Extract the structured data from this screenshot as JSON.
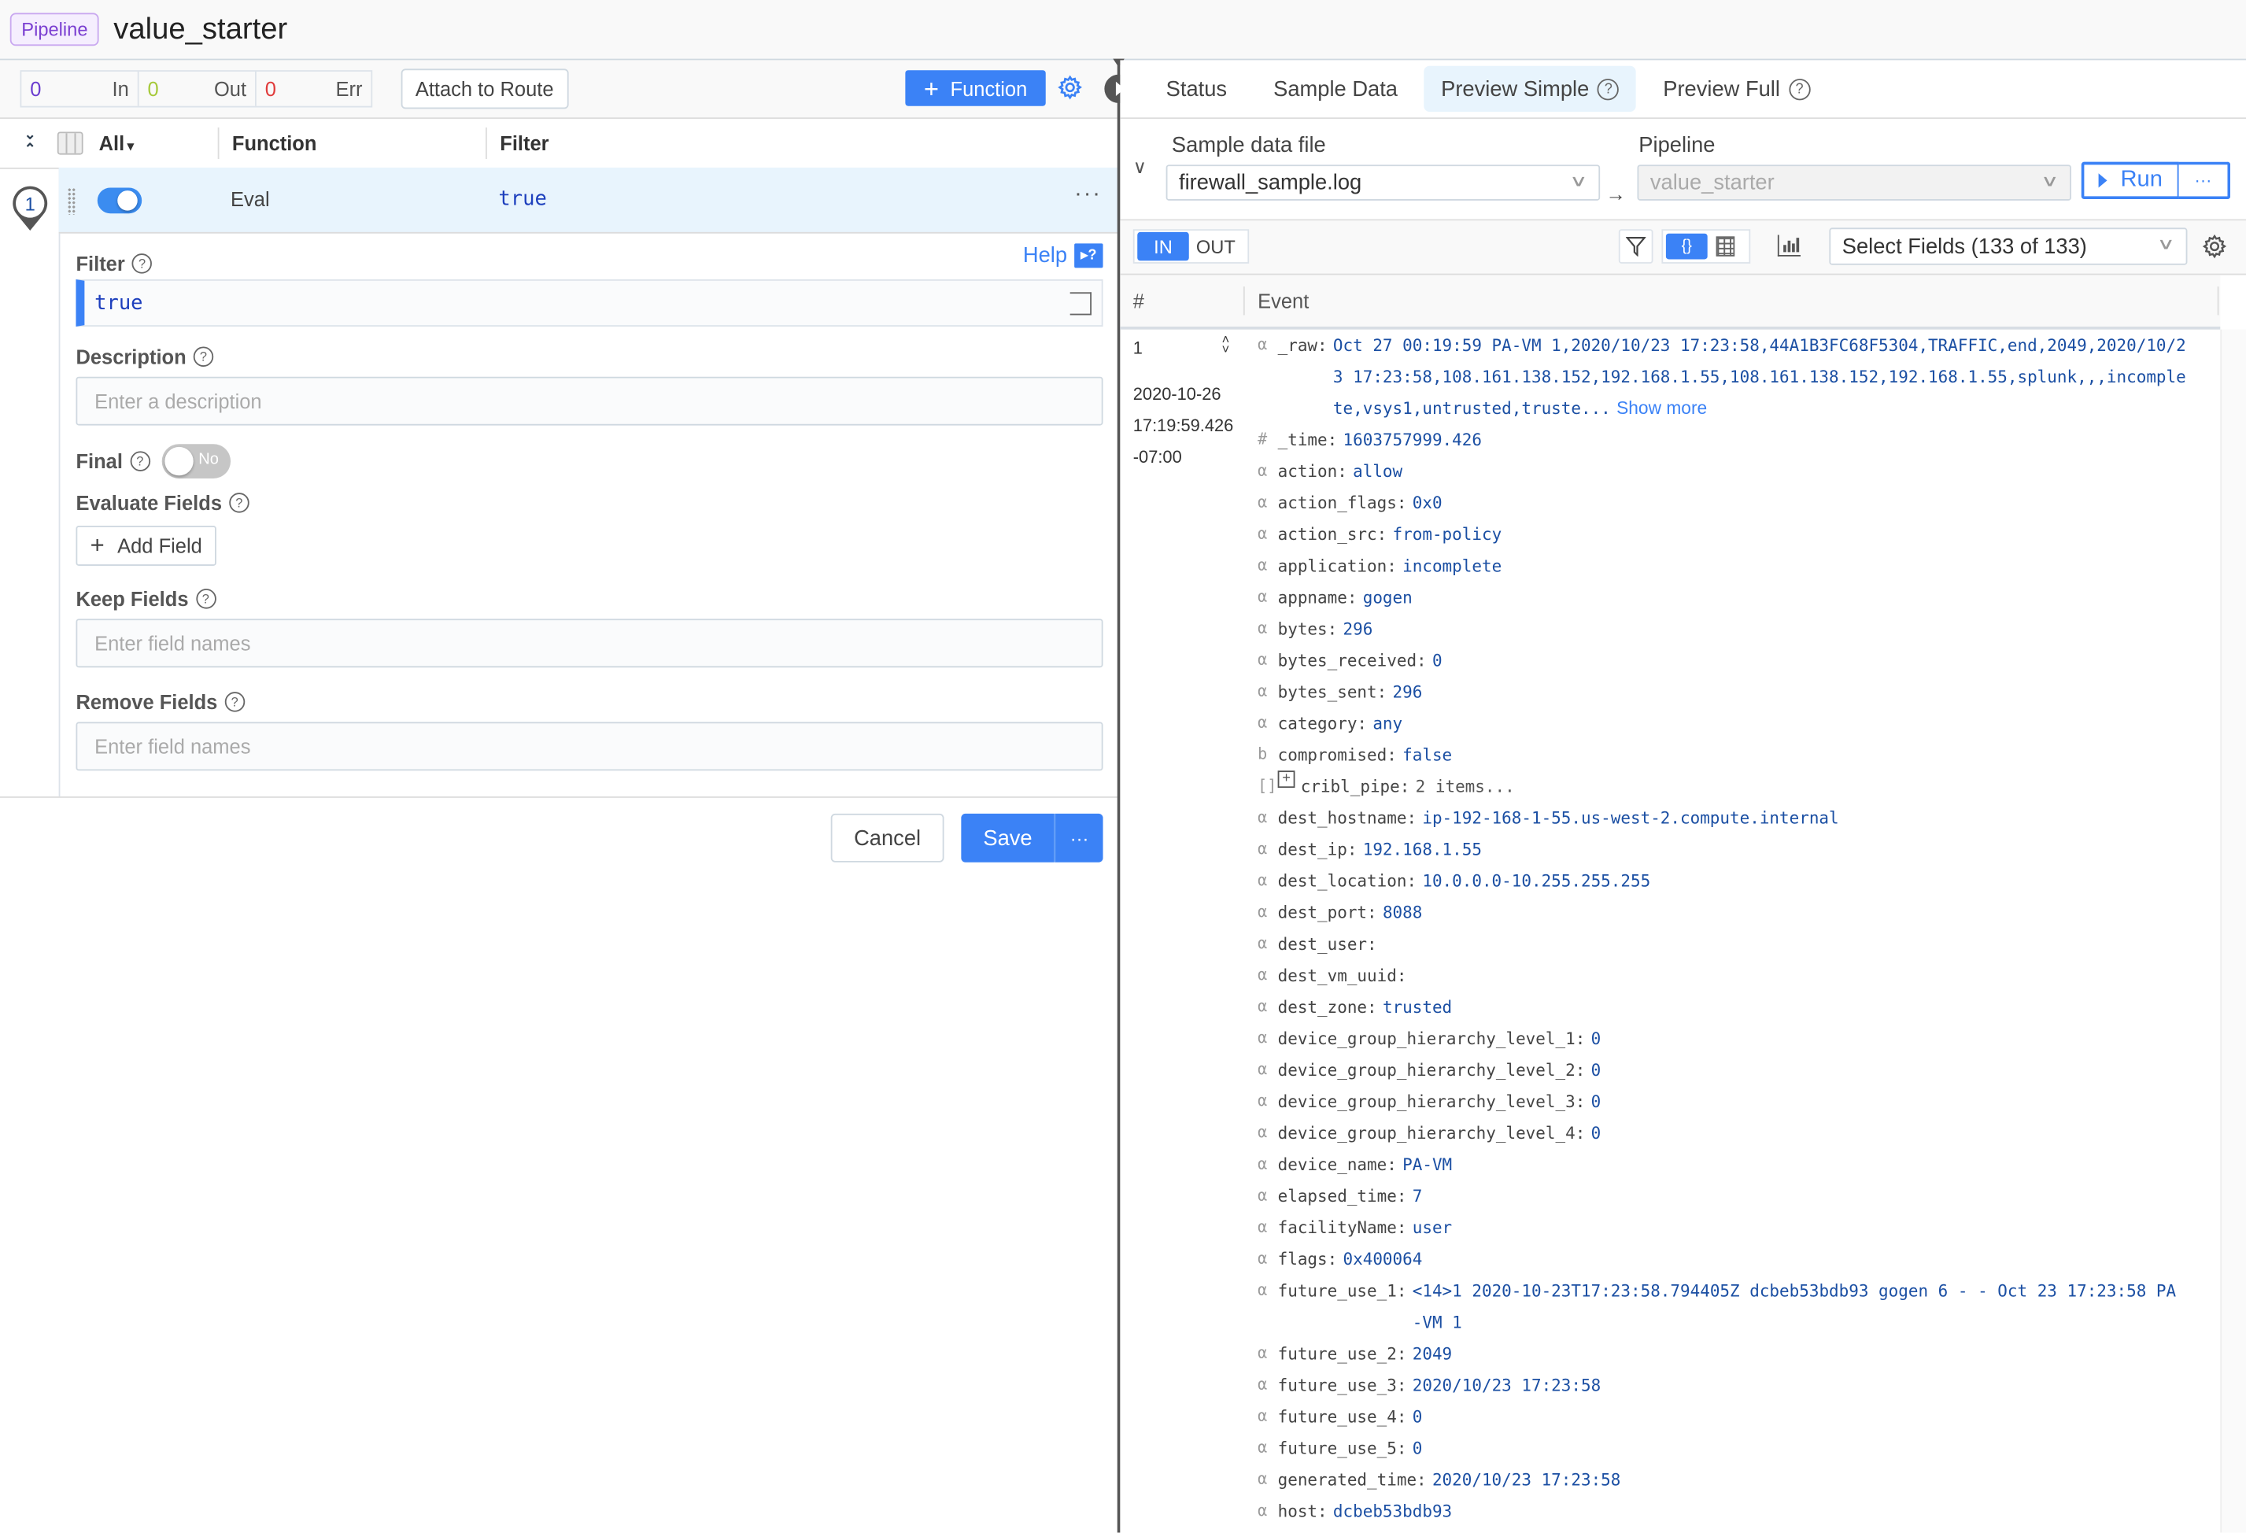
{
  "header": {
    "badge": "Pipeline",
    "title": "value_starter"
  },
  "left_toolbar": {
    "stats": [
      {
        "value": "0",
        "label": "In",
        "color": "#6a3ccf"
      },
      {
        "value": "0",
        "label": "Out",
        "color": "#a6c93a"
      },
      {
        "value": "0",
        "label": "Err",
        "color": "#e03b3b"
      }
    ],
    "attach_label": "Attach to Route",
    "add_function_label": "Function",
    "add_function_plus": "+"
  },
  "function_table": {
    "all_label": "All",
    "all_caret": "▾",
    "col_function": "Function",
    "col_filter": "Filter",
    "rows": [
      {
        "index": "1",
        "enabled": true,
        "name": "Eval",
        "filter": "true",
        "more": "···"
      }
    ]
  },
  "form": {
    "filter_label": "Filter",
    "help_label": "Help",
    "help_icon": "▸?",
    "filter_value": "true",
    "description_label": "Description",
    "description_placeholder": "Enter a description",
    "final_label": "Final",
    "final_value": "No",
    "evaluate_label": "Evaluate Fields",
    "add_field_label": "Add Field",
    "add_field_plus": "+",
    "keep_label": "Keep Fields",
    "keep_placeholder": "Enter field names",
    "remove_label": "Remove Fields",
    "remove_placeholder": "Enter field names",
    "help_q": "?",
    "cancel_label": "Cancel",
    "save_label": "Save",
    "save_more": "···"
  },
  "right_tabs": [
    {
      "label": "Status",
      "active": false,
      "help": false
    },
    {
      "label": "Sample Data",
      "active": false,
      "help": false
    },
    {
      "label": "Preview Simple",
      "active": true,
      "help": true
    },
    {
      "label": "Preview Full",
      "active": false,
      "help": true
    }
  ],
  "sample": {
    "file_label": "Sample data file",
    "file_value": "firewall_sample.log",
    "pipeline_label": "Pipeline",
    "pipeline_value": "value_starter",
    "run_label": "Run",
    "run_more": "···",
    "arrow": "→",
    "chevron": "∨"
  },
  "preview_toolbar": {
    "in_label": "IN",
    "out_label": "OUT",
    "json_view_label": "{}",
    "select_fields_label": "Select Fields (133 of 133)"
  },
  "events": {
    "col_num": "#",
    "col_event": "Event",
    "items": [
      {
        "num": "1",
        "date": "2020-10-26",
        "time": "17:19:59.426",
        "tz": "-07:00",
        "raw_show_more": "Show more",
        "fields": [
          {
            "type": "α",
            "key": "_raw:",
            "value": "Oct 27 00:19:59 PA-VM 1,2020/10/23 17:23:58,44A1B3FC68F5304,TRAFFIC,end,2049,2020/10/23 17:23:58,108.161.138.152,192.168.1.55,108.161.138.152,192.168.1.55,splunk,,,incomplete,vsys1,untrusted,truste..."
          },
          {
            "type": "#",
            "key": "_time:",
            "value": "1603757999.426"
          },
          {
            "type": "α",
            "key": "action:",
            "value": "allow"
          },
          {
            "type": "α",
            "key": "action_flags:",
            "value": "0x0"
          },
          {
            "type": "α",
            "key": "action_src:",
            "value": "from-policy"
          },
          {
            "type": "α",
            "key": "application:",
            "value": "incomplete"
          },
          {
            "type": "α",
            "key": "appname:",
            "value": "gogen"
          },
          {
            "type": "α",
            "key": "bytes:",
            "value": "296"
          },
          {
            "type": "α",
            "key": "bytes_received:",
            "value": "0"
          },
          {
            "type": "α",
            "key": "bytes_sent:",
            "value": "296"
          },
          {
            "type": "α",
            "key": "category:",
            "value": "any"
          },
          {
            "type": "b",
            "key": "compromised:",
            "value": "false"
          },
          {
            "type": "[]",
            "key": "cribl_pipe:",
            "value": "2 items...",
            "expandable": true
          },
          {
            "type": "α",
            "key": "dest_hostname:",
            "value": "ip-192-168-1-55.us-west-2.compute.internal"
          },
          {
            "type": "α",
            "key": "dest_ip:",
            "value": "192.168.1.55"
          },
          {
            "type": "α",
            "key": "dest_location:",
            "value": "10.0.0.0-10.255.255.255"
          },
          {
            "type": "α",
            "key": "dest_port:",
            "value": "8088"
          },
          {
            "type": "α",
            "key": "dest_user:",
            "value": ""
          },
          {
            "type": "α",
            "key": "dest_vm_uuid:",
            "value": ""
          },
          {
            "type": "α",
            "key": "dest_zone:",
            "value": "trusted"
          },
          {
            "type": "α",
            "key": "device_group_hierarchy_level_1:",
            "value": "0"
          },
          {
            "type": "α",
            "key": "device_group_hierarchy_level_2:",
            "value": "0"
          },
          {
            "type": "α",
            "key": "device_group_hierarchy_level_3:",
            "value": "0"
          },
          {
            "type": "α",
            "key": "device_group_hierarchy_level_4:",
            "value": "0"
          },
          {
            "type": "α",
            "key": "device_name:",
            "value": "PA-VM"
          },
          {
            "type": "α",
            "key": "elapsed_time:",
            "value": "7"
          },
          {
            "type": "α",
            "key": "facilityName:",
            "value": "user"
          },
          {
            "type": "α",
            "key": "flags:",
            "value": "0x400064"
          },
          {
            "type": "α",
            "key": "future_use_1:",
            "value": "<14>1 2020-10-23T17:23:58.794405Z dcbeb53bdb93 gogen 6 - - Oct 23 17:23:58 PA-VM 1"
          },
          {
            "type": "α",
            "key": "future_use_2:",
            "value": "2049"
          },
          {
            "type": "α",
            "key": "future_use_3:",
            "value": "2020/10/23 17:23:58"
          },
          {
            "type": "α",
            "key": "future_use_4:",
            "value": "0"
          },
          {
            "type": "α",
            "key": "future_use_5:",
            "value": "0"
          },
          {
            "type": "α",
            "key": "generated_time:",
            "value": "2020/10/23 17:23:58"
          },
          {
            "type": "α",
            "key": "host:",
            "value": "dcbeb53bdb93"
          }
        ]
      }
    ]
  },
  "colors": {
    "accent": "#3b82f6",
    "row_highlight": "#e8f4fd",
    "value_blue": "#1b4fa3",
    "in": "#6a3ccf",
    "out": "#a6c93a",
    "err": "#e03b3b"
  }
}
